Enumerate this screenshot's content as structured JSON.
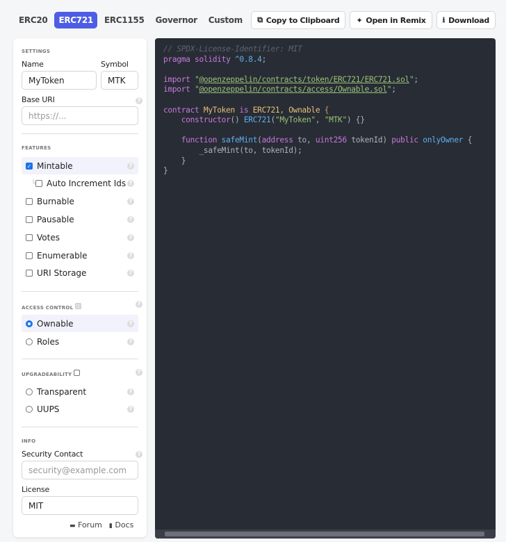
{
  "tabs": [
    {
      "label": "ERC20"
    },
    {
      "label": "ERC721",
      "active": true
    },
    {
      "label": "ERC1155"
    },
    {
      "label": "Governor"
    },
    {
      "label": "Custom"
    }
  ],
  "actions": {
    "copy": "Copy to Clipboard",
    "remix": "Open in Remix",
    "download": "Download"
  },
  "settings": {
    "section": "SETTINGS",
    "name_label": "Name",
    "name_value": "MyToken",
    "symbol_label": "Symbol",
    "symbol_value": "MTK",
    "base_uri_label": "Base URI",
    "base_uri_placeholder": "https://..."
  },
  "features": {
    "section": "FEATURES",
    "items": [
      {
        "label": "Mintable",
        "checked": true
      },
      {
        "label": "Auto Increment Ids",
        "checked": false
      },
      {
        "label": "Burnable",
        "checked": false
      },
      {
        "label": "Pausable",
        "checked": false
      },
      {
        "label": "Votes",
        "checked": false
      },
      {
        "label": "Enumerable",
        "checked": false
      },
      {
        "label": "URI Storage",
        "checked": false
      }
    ]
  },
  "access": {
    "section": "ACCESS CONTROL",
    "options": [
      {
        "label": "Ownable",
        "selected": true
      },
      {
        "label": "Roles",
        "selected": false
      }
    ]
  },
  "upgrade": {
    "section": "UPGRADEABILITY",
    "options": [
      {
        "label": "Transparent"
      },
      {
        "label": "UUPS"
      }
    ]
  },
  "info": {
    "section": "INFO",
    "contact_label": "Security Contact",
    "contact_placeholder": "security@example.com",
    "license_label": "License",
    "license_value": "MIT"
  },
  "footer": {
    "forum": "Forum",
    "docs": "Docs"
  },
  "code_colors": {
    "comment": "#5c6370",
    "kw": "#c678dd",
    "str": "#98c379",
    "fn": "#61afef",
    "type": "#e5c07b",
    "num": "#d19a66",
    "plain": "#abb2bf",
    "link": "#98c379"
  },
  "code": [
    [
      [
        "comment",
        "// SPDX-License-Identifier: MIT"
      ]
    ],
    [
      [
        "kw",
        "pragma solidity "
      ],
      [
        "fn",
        "^0.8.4"
      ],
      [
        "plain",
        ";"
      ]
    ],
    [],
    [
      [
        "kw",
        "import "
      ],
      [
        "str",
        "\""
      ],
      [
        "link",
        "@openzeppelin/contracts/token/ERC721/ERC721.sol"
      ],
      [
        "str",
        "\""
      ],
      [
        "plain",
        ";"
      ]
    ],
    [
      [
        "kw",
        "import "
      ],
      [
        "str",
        "\""
      ],
      [
        "link",
        "@openzeppelin/contracts/access/Ownable.sol"
      ],
      [
        "str",
        "\""
      ],
      [
        "plain",
        ";"
      ]
    ],
    [],
    [
      [
        "kw",
        "contract "
      ],
      [
        "type",
        "MyToken "
      ],
      [
        "kw",
        "is "
      ],
      [
        "type",
        "ERC721"
      ],
      [
        "plain",
        ", "
      ],
      [
        "type",
        "Ownable "
      ],
      [
        "num",
        "{"
      ]
    ],
    [
      [
        "plain",
        "    "
      ],
      [
        "kw",
        "constructor"
      ],
      [
        "plain",
        "() "
      ],
      [
        "fn",
        "ERC721"
      ],
      [
        "plain",
        "("
      ],
      [
        "str",
        "\"MyToken\""
      ],
      [
        "plain",
        ", "
      ],
      [
        "str",
        "\"MTK\""
      ],
      [
        "plain",
        ") {}"
      ]
    ],
    [],
    [
      [
        "plain",
        "    "
      ],
      [
        "kw",
        "function "
      ],
      [
        "fn",
        "safeMint"
      ],
      [
        "plain",
        "("
      ],
      [
        "kw",
        "address "
      ],
      [
        "plain",
        "to, "
      ],
      [
        "kw",
        "uint256 "
      ],
      [
        "plain",
        "tokenId) "
      ],
      [
        "kw",
        "public "
      ],
      [
        "fn",
        "onlyOwner"
      ],
      [
        "plain",
        " {"
      ]
    ],
    [
      [
        "plain",
        "        _safeMint(to, tokenId);"
      ]
    ],
    [
      [
        "plain",
        "    }"
      ]
    ],
    [
      [
        "plain",
        "}"
      ]
    ]
  ]
}
